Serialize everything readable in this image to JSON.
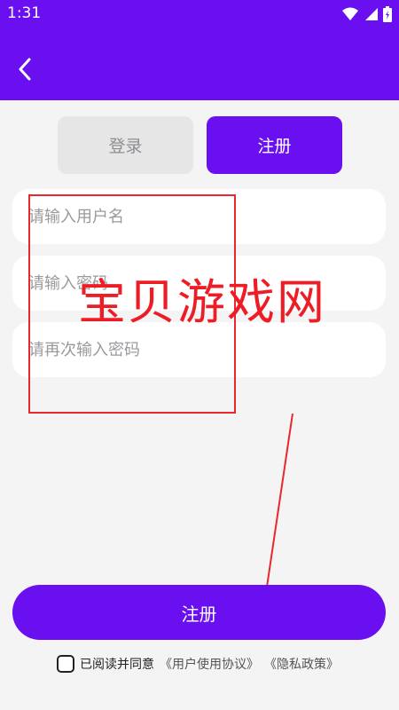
{
  "status_bar": {
    "time": "1:31"
  },
  "tabs": {
    "login": "登录",
    "register": "注册"
  },
  "form": {
    "username_placeholder": "请输入用户名",
    "password_placeholder": "请输入密码",
    "confirm_placeholder": "请再次输入密码"
  },
  "submit_label": "注册",
  "agreement": {
    "prefix": "已阅读并同意",
    "user_agreement": "《用户使用协议》",
    "privacy_policy": "《隐私政策》"
  },
  "watermark": "宝贝游戏网",
  "colors": {
    "primary": "#6a10f0",
    "background": "#f4f4f5",
    "annotation": "#e8282c"
  },
  "icons": [
    "wifi-icon",
    "signal-icon",
    "battery-icon",
    "back-arrow-icon"
  ]
}
